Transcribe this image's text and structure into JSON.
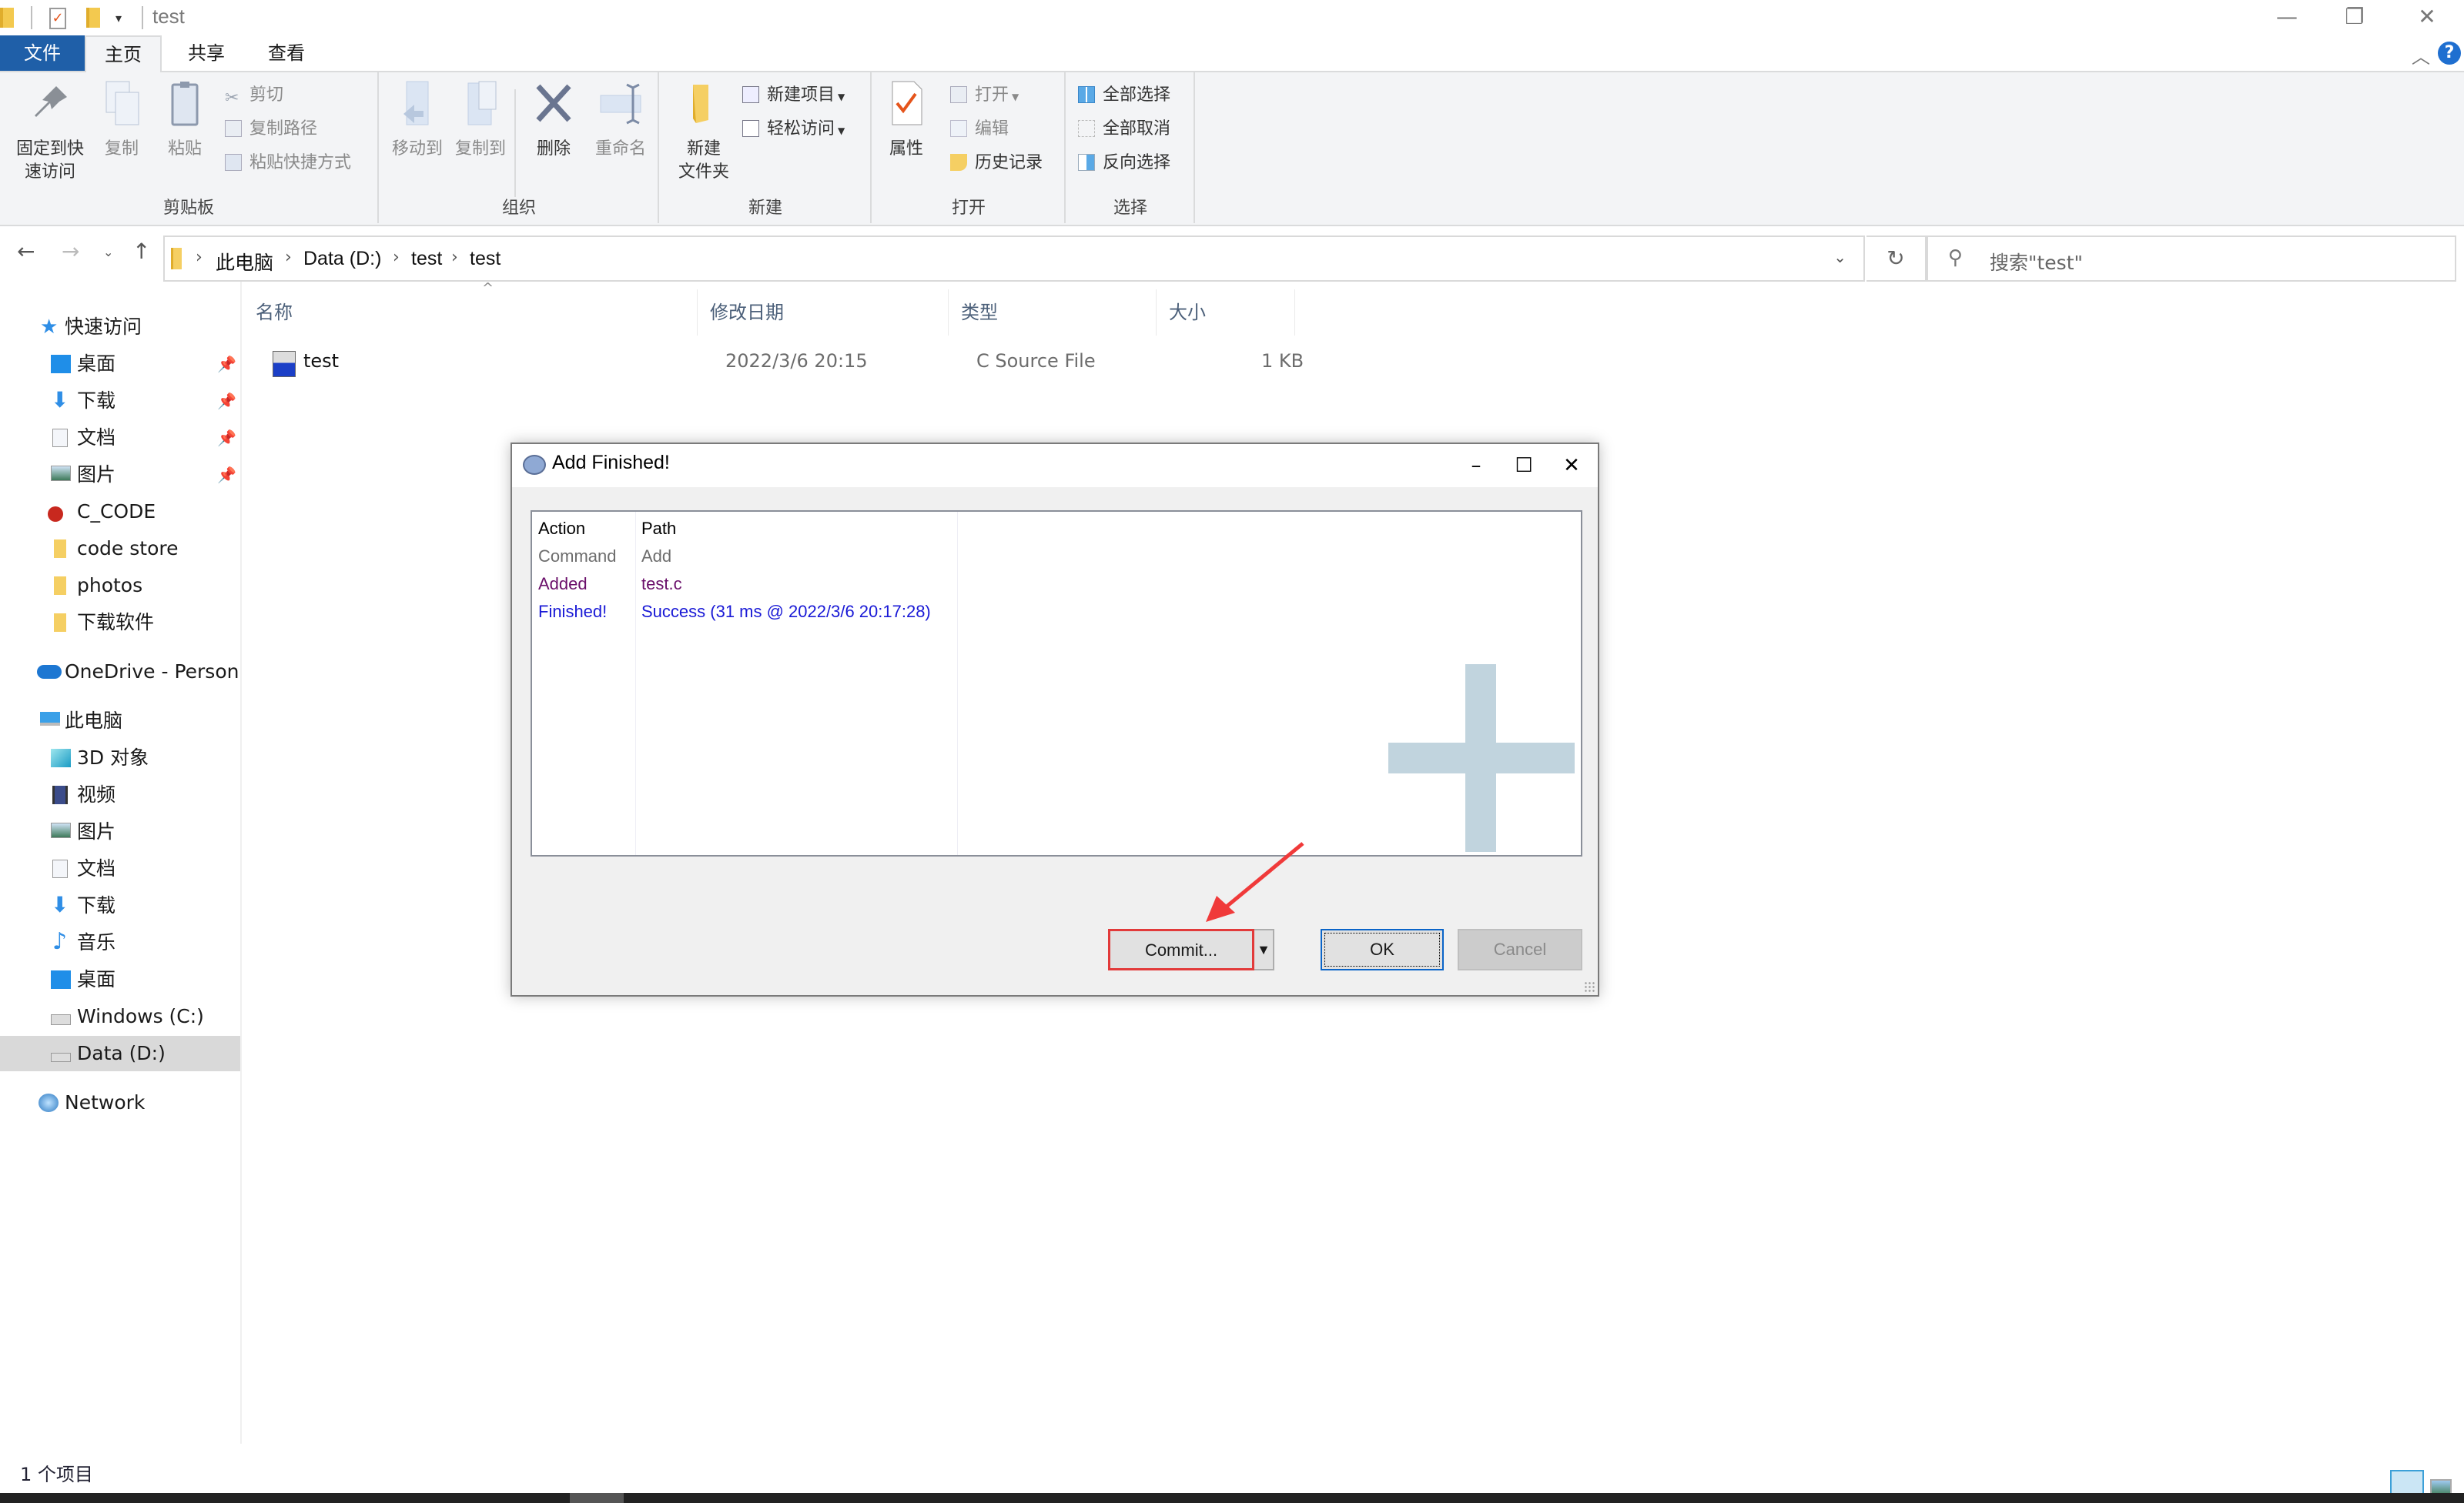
{
  "window": {
    "title": "test",
    "controls": {
      "minimize": "—",
      "restore": "❐",
      "close": "✕"
    }
  },
  "ribbon_tabs": [
    {
      "label": "文件"
    },
    {
      "label": "主页"
    },
    {
      "label": "共享"
    },
    {
      "label": "查看"
    }
  ],
  "ribbon": {
    "clipboard": {
      "label": "剪贴板",
      "pin": "固定到快\n速访问",
      "pin_l1": "固定到快",
      "pin_l2": "速访问",
      "copy": "复制",
      "paste": "粘贴",
      "cut": "剪切",
      "copy_path": "复制路径",
      "paste_shortcut": "粘贴快捷方式"
    },
    "organize": {
      "label": "组织",
      "move_to": "移动到",
      "copy_to": "复制到",
      "delete": "删除",
      "rename": "重命名"
    },
    "new": {
      "label": "新建",
      "new_folder_l1": "新建",
      "new_folder_l2": "文件夹",
      "new_item": "新建项目",
      "easy_access": "轻松访问"
    },
    "open": {
      "label": "打开",
      "properties": "属性",
      "open": "打开",
      "edit": "编辑",
      "history": "历史记录"
    },
    "select": {
      "label": "选择",
      "select_all": "全部选择",
      "select_none": "全部取消",
      "invert": "反向选择"
    }
  },
  "navigation": {
    "breadcrumb": [
      "此电脑",
      "Data (D:)",
      "test",
      "test"
    ],
    "search_placeholder": "搜索\"test\""
  },
  "sidebar": {
    "quick_access": {
      "label": "快速访问",
      "items": [
        {
          "label": "桌面",
          "pinned": true
        },
        {
          "label": "下载",
          "pinned": true
        },
        {
          "label": "文档",
          "pinned": true
        },
        {
          "label": "图片",
          "pinned": true
        },
        {
          "label": "C_CODE",
          "pinned": false
        },
        {
          "label": "code store",
          "pinned": false
        },
        {
          "label": "photos",
          "pinned": false
        },
        {
          "label": "下载软件",
          "pinned": false
        }
      ]
    },
    "onedrive": {
      "label": "OneDrive - Persona"
    },
    "this_pc": {
      "label": "此电脑",
      "items": [
        {
          "label": "3D 对象"
        },
        {
          "label": "视频"
        },
        {
          "label": "图片"
        },
        {
          "label": "文档"
        },
        {
          "label": "下载"
        },
        {
          "label": "音乐"
        },
        {
          "label": "桌面"
        },
        {
          "label": "Windows (C:)"
        },
        {
          "label": "Data (D:)",
          "selected": true
        }
      ]
    },
    "network": {
      "label": "Network"
    },
    "pin_glyph": "📌"
  },
  "file_list": {
    "columns": [
      "名称",
      "修改日期",
      "类型",
      "大小"
    ],
    "rows": [
      {
        "name": "test",
        "modified": "2022/3/6 20:15",
        "type": "C Source File",
        "size": "1 KB"
      }
    ]
  },
  "status_bar": {
    "item_count": "1 个项目"
  },
  "dialog": {
    "title": "Add Finished!",
    "log_columns": [
      "Action",
      "Path"
    ],
    "log_rows": [
      {
        "action": "Command",
        "path": "Add",
        "color": "#6d6d6d"
      },
      {
        "action": "Added",
        "path": "test.c",
        "color": "#6a0f6a"
      },
      {
        "action": "Finished!",
        "path": "Success (31 ms @ 2022/3/6 20:17:28)",
        "color": "#1a1ad6"
      }
    ],
    "buttons": {
      "commit": "Commit...",
      "ok": "OK",
      "cancel": "Cancel"
    },
    "accent_highlight": "#e23a3a"
  }
}
